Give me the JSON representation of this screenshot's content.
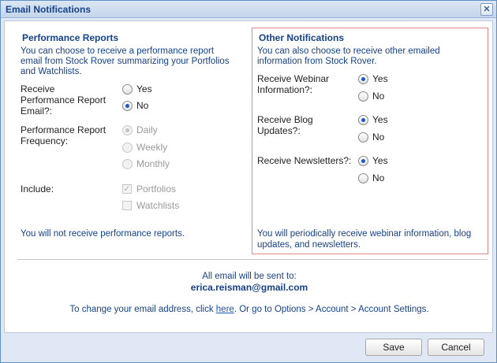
{
  "dialog": {
    "title": "Email Notifications"
  },
  "performance": {
    "heading": "Performance Reports",
    "description": "You can choose to receive a performance report email from Stock Rover summarizing your Portfolios and Watchlists.",
    "receive_label": "Receive Performance Report Email?:",
    "receive_yes": "Yes",
    "receive_no": "No",
    "receive_selected": "No",
    "frequency_label": "Performance Report Frequency:",
    "frequency_options": [
      "Daily",
      "Weekly",
      "Monthly"
    ],
    "frequency_selected": "Daily",
    "include_label": "Include:",
    "include_portfolios": "Portfolios",
    "include_watchlists": "Watchlists",
    "include_portfolios_checked": true,
    "include_watchlists_checked": false,
    "status_note": "You will not receive performance reports."
  },
  "other": {
    "heading": "Other Notifications",
    "description": "You can also choose to receive other emailed information from Stock Rover.",
    "webinar_label": "Receive Webinar Information?:",
    "webinar_selected": "Yes",
    "blog_label": "Receive Blog Updates?:",
    "blog_selected": "Yes",
    "newsletter_label": "Receive Newsletters?:",
    "newsletter_selected": "Yes",
    "yes": "Yes",
    "no": "No",
    "status_note": "You will periodically receive webinar information, blog updates, and newsletters."
  },
  "email_info": {
    "sent_to_label": "All email will be sent to:",
    "address": "erica.reisman@gmail.com",
    "change_prefix": "To change your email address, click ",
    "change_link": "here",
    "change_suffix": ". Or go to Options > Account > Account Settings."
  },
  "footer": {
    "save_label": "Save",
    "cancel_label": "Cancel"
  },
  "colors": {
    "title_text": "#15428b",
    "accent_radio": "#1b57c7",
    "highlight_border": "#e08a8a"
  }
}
